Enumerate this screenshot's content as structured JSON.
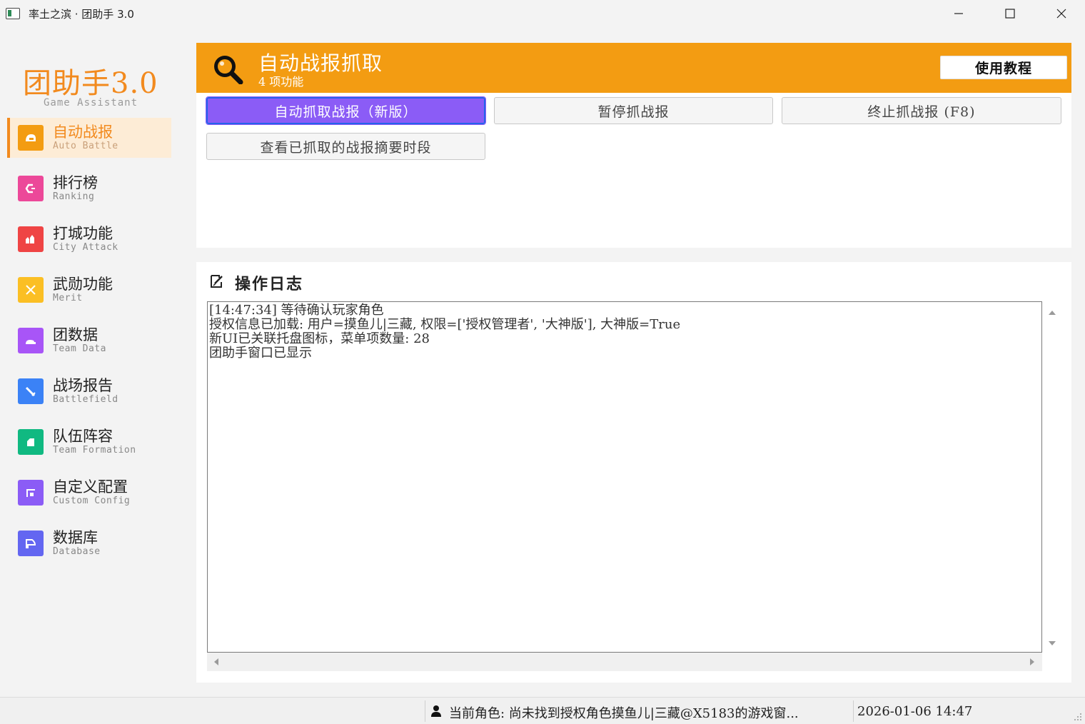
{
  "window": {
    "title": "率土之滨 · 团助手 3.0",
    "controls": [
      "minimize-icon",
      "maximize-icon",
      "close-icon"
    ]
  },
  "sidebar": {
    "brand": "团助手3.0",
    "brand_sub": "Game Assistant",
    "items": [
      {
        "label": "自动战报",
        "sub": "Auto Battle",
        "color": "#f39c12",
        "icon": "helmet-icon",
        "active": true
      },
      {
        "label": "排行榜",
        "sub": "Ranking",
        "color": "#ec4899",
        "icon": "ranking-icon"
      },
      {
        "label": "打城功能",
        "sub": "City Attack",
        "color": "#ef4444",
        "icon": "castle-icon"
      },
      {
        "label": "武勋功能",
        "sub": "Merit",
        "color": "#fbbf24",
        "icon": "crossed-swords-icon"
      },
      {
        "label": "团数据",
        "sub": "Team Data",
        "color": "#a855f7",
        "icon": "team-icon"
      },
      {
        "label": "战场报告",
        "sub": "Battlefield",
        "color": "#3b82f6",
        "icon": "sword-icon"
      },
      {
        "label": "队伍阵容",
        "sub": "Team Formation",
        "color": "#10b981",
        "icon": "formation-icon"
      },
      {
        "label": "自定义配置",
        "sub": "Custom Config",
        "color": "#8b5cf6",
        "icon": "config-icon"
      },
      {
        "label": "数据库",
        "sub": "Database",
        "color": "#6366f1",
        "icon": "database-icon"
      }
    ]
  },
  "header": {
    "icon": "magnifier-icon",
    "title": "自动战报抓取",
    "subtitle": "4 项功能",
    "tutorial_label": "使用教程",
    "accent": "#f39c12"
  },
  "functions": [
    {
      "label": "自动抓取战报（新版）",
      "primary": true
    },
    {
      "label": "暂停抓战报"
    },
    {
      "label": "终止抓战报 (F8)"
    },
    {
      "label": "查看已抓取的战报摘要时段"
    }
  ],
  "log": {
    "heading": "操作日志",
    "heading_icon": "edit-note-icon",
    "lines": [
      "[14:47:34] 等待确认玩家角色",
      "授权信息已加载: 用户=摸鱼儿|三藏, 权限=['授权管理者', '大神版'], 大神版=True",
      "新UI已关联托盘图标，菜单项数量: 28",
      "团助手窗口已显示"
    ]
  },
  "status": {
    "user_icon": "user-icon",
    "role_text": "当前角色: 尚未找到授权角色摸鱼儿|三藏@X5183的游戏窗...",
    "datetime": "2026-01-06 14:47"
  }
}
